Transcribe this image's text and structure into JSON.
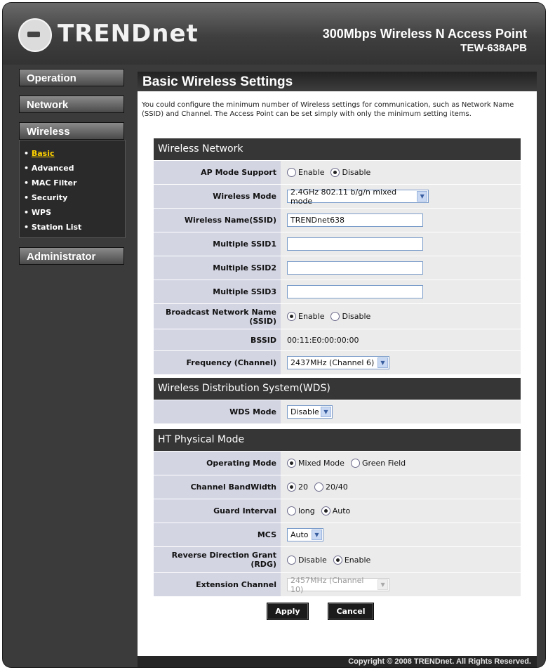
{
  "brand": {
    "logo_text": "TRENDnet",
    "product_name": "300Mbps Wireless N Access Point",
    "model": "TEW-638APB"
  },
  "sidebar": {
    "operation": "Operation",
    "network": "Network",
    "wireless": "Wireless",
    "wireless_items": [
      "Basic",
      "Advanced",
      "MAC Filter",
      "Security",
      "WPS",
      "Station List"
    ],
    "administrator": "Administrator"
  },
  "page": {
    "title": "Basic Wireless Settings",
    "description": "You could configure the minimum number of Wireless settings for communication, such as Network Name (SSID) and Channel. The Access Point can be set simply with only the minimum setting items."
  },
  "wireless_network": {
    "header": "Wireless Network",
    "ap_mode_label": "AP Mode Support",
    "ap_mode_enable": "Enable",
    "ap_mode_disable": "Disable",
    "wireless_mode_label": "Wireless Mode",
    "wireless_mode_value": "2.4GHz 802.11 b/g/n mixed mode",
    "ssid_label": "Wireless Name(SSID)",
    "ssid_value": "TRENDnet638",
    "ssid1_label": "Multiple SSID1",
    "ssid2_label": "Multiple SSID2",
    "ssid3_label": "Multiple SSID3",
    "broadcast_label": "Broadcast Network Name (SSID)",
    "broadcast_enable": "Enable",
    "broadcast_disable": "Disable",
    "bssid_label": "BSSID",
    "bssid_value": "00:11:E0:00:00:00",
    "frequency_label": "Frequency (Channel)",
    "frequency_value": "2437MHz (Channel 6)"
  },
  "wds": {
    "header": "Wireless Distribution System(WDS)",
    "mode_label": "WDS Mode",
    "mode_value": "Disable"
  },
  "ht": {
    "header": "HT Physical Mode",
    "op_mode_label": "Operating Mode",
    "op_mixed": "Mixed Mode",
    "op_green": "Green Field",
    "bandwidth_label": "Channel BandWidth",
    "bw_20": "20",
    "bw_2040": "20/40",
    "guard_label": "Guard Interval",
    "guard_long": "long",
    "guard_auto": "Auto",
    "mcs_label": "MCS",
    "mcs_value": "Auto",
    "rdg_label": "Reverse Direction Grant (RDG)",
    "rdg_disable": "Disable",
    "rdg_enable": "Enable",
    "ext_label": "Extension Channel",
    "ext_value": "2457MHz (Channel 10)"
  },
  "buttons": {
    "apply": "Apply",
    "cancel": "Cancel"
  },
  "footer": {
    "copyright": "Copyright © 2008 TRENDnet. All Rights Reserved."
  }
}
